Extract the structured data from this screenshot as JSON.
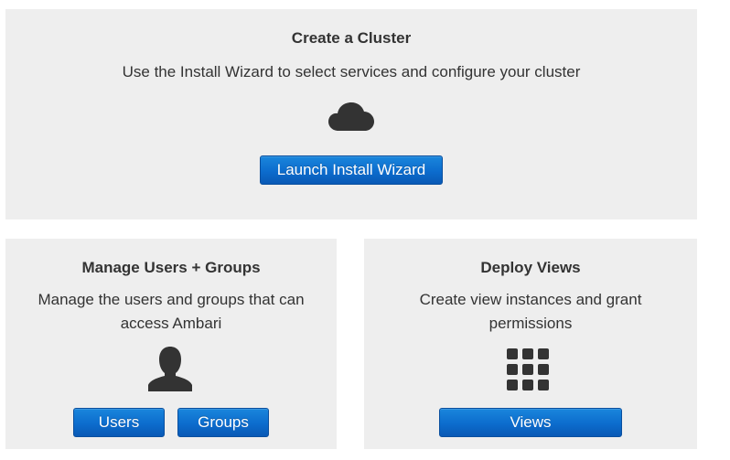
{
  "create_cluster": {
    "title": "Create a Cluster",
    "description": "Use the Install Wizard to select services and configure your cluster",
    "icon": "cloud-icon",
    "button_label": "Launch Install Wizard"
  },
  "manage_users": {
    "title": "Manage Users + Groups",
    "description_line1": "Manage the users and groups that can",
    "description_line2": "access Ambari",
    "icon": "user-icon",
    "users_button_label": "Users",
    "groups_button_label": "Groups"
  },
  "deploy_views": {
    "title": "Deploy Views",
    "description_line1": "Create view instances and grant",
    "description_line2": "permissions",
    "icon": "grid-icon",
    "views_button_label": "Views"
  },
  "colors": {
    "panel_background": "#eeeeee",
    "button_blue": "#0c6ccd",
    "icon_dark": "#333333"
  }
}
